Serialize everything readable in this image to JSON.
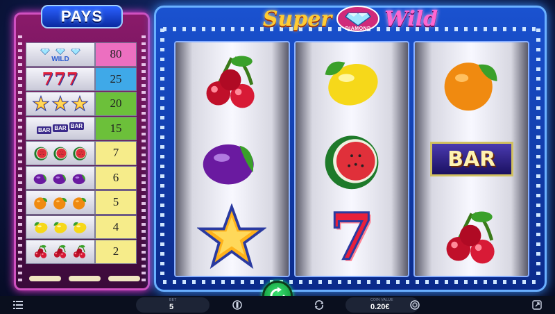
{
  "game": {
    "logo_left": "Super",
    "logo_badge": "DIAMOND",
    "logo_right": "Wild"
  },
  "paytable": {
    "title": "PAYS",
    "rows": [
      {
        "symbol": "wild-diamond",
        "payout": "80",
        "color": "#ec6fc0"
      },
      {
        "symbol": "seven",
        "payout": "25",
        "color": "#3fa9e8"
      },
      {
        "symbol": "star",
        "payout": "20",
        "color": "#6cc03a"
      },
      {
        "symbol": "bar",
        "payout": "15",
        "color": "#6cc03a"
      },
      {
        "symbol": "watermelon",
        "payout": "7",
        "color": "#f6ec8a"
      },
      {
        "symbol": "plum",
        "payout": "6",
        "color": "#f6ec8a"
      },
      {
        "symbol": "orange",
        "payout": "5",
        "color": "#f6ec8a"
      },
      {
        "symbol": "lemon",
        "payout": "4",
        "color": "#f6ec8a"
      },
      {
        "symbol": "cherries",
        "payout": "2",
        "color": "#f6ec8a"
      }
    ],
    "wild_text": "WILD",
    "seven_text": "777",
    "bar_text": "BAR"
  },
  "reels": [
    [
      "cherries",
      "plum",
      "star"
    ],
    [
      "lemon",
      "watermelon",
      "seven"
    ],
    [
      "orange",
      "bar",
      "cherries"
    ]
  ],
  "reel_text": {
    "bar": "BAR",
    "seven": "7"
  },
  "bottom_bar": {
    "bet_label": "BET",
    "bet_value": "5",
    "coin_label": "COIN VALUE",
    "coin_value": "0.20€"
  },
  "colors": {
    "cabinet": "#1a52d0",
    "paytable": "#8a1a6a",
    "spin": "#1fbf55"
  }
}
